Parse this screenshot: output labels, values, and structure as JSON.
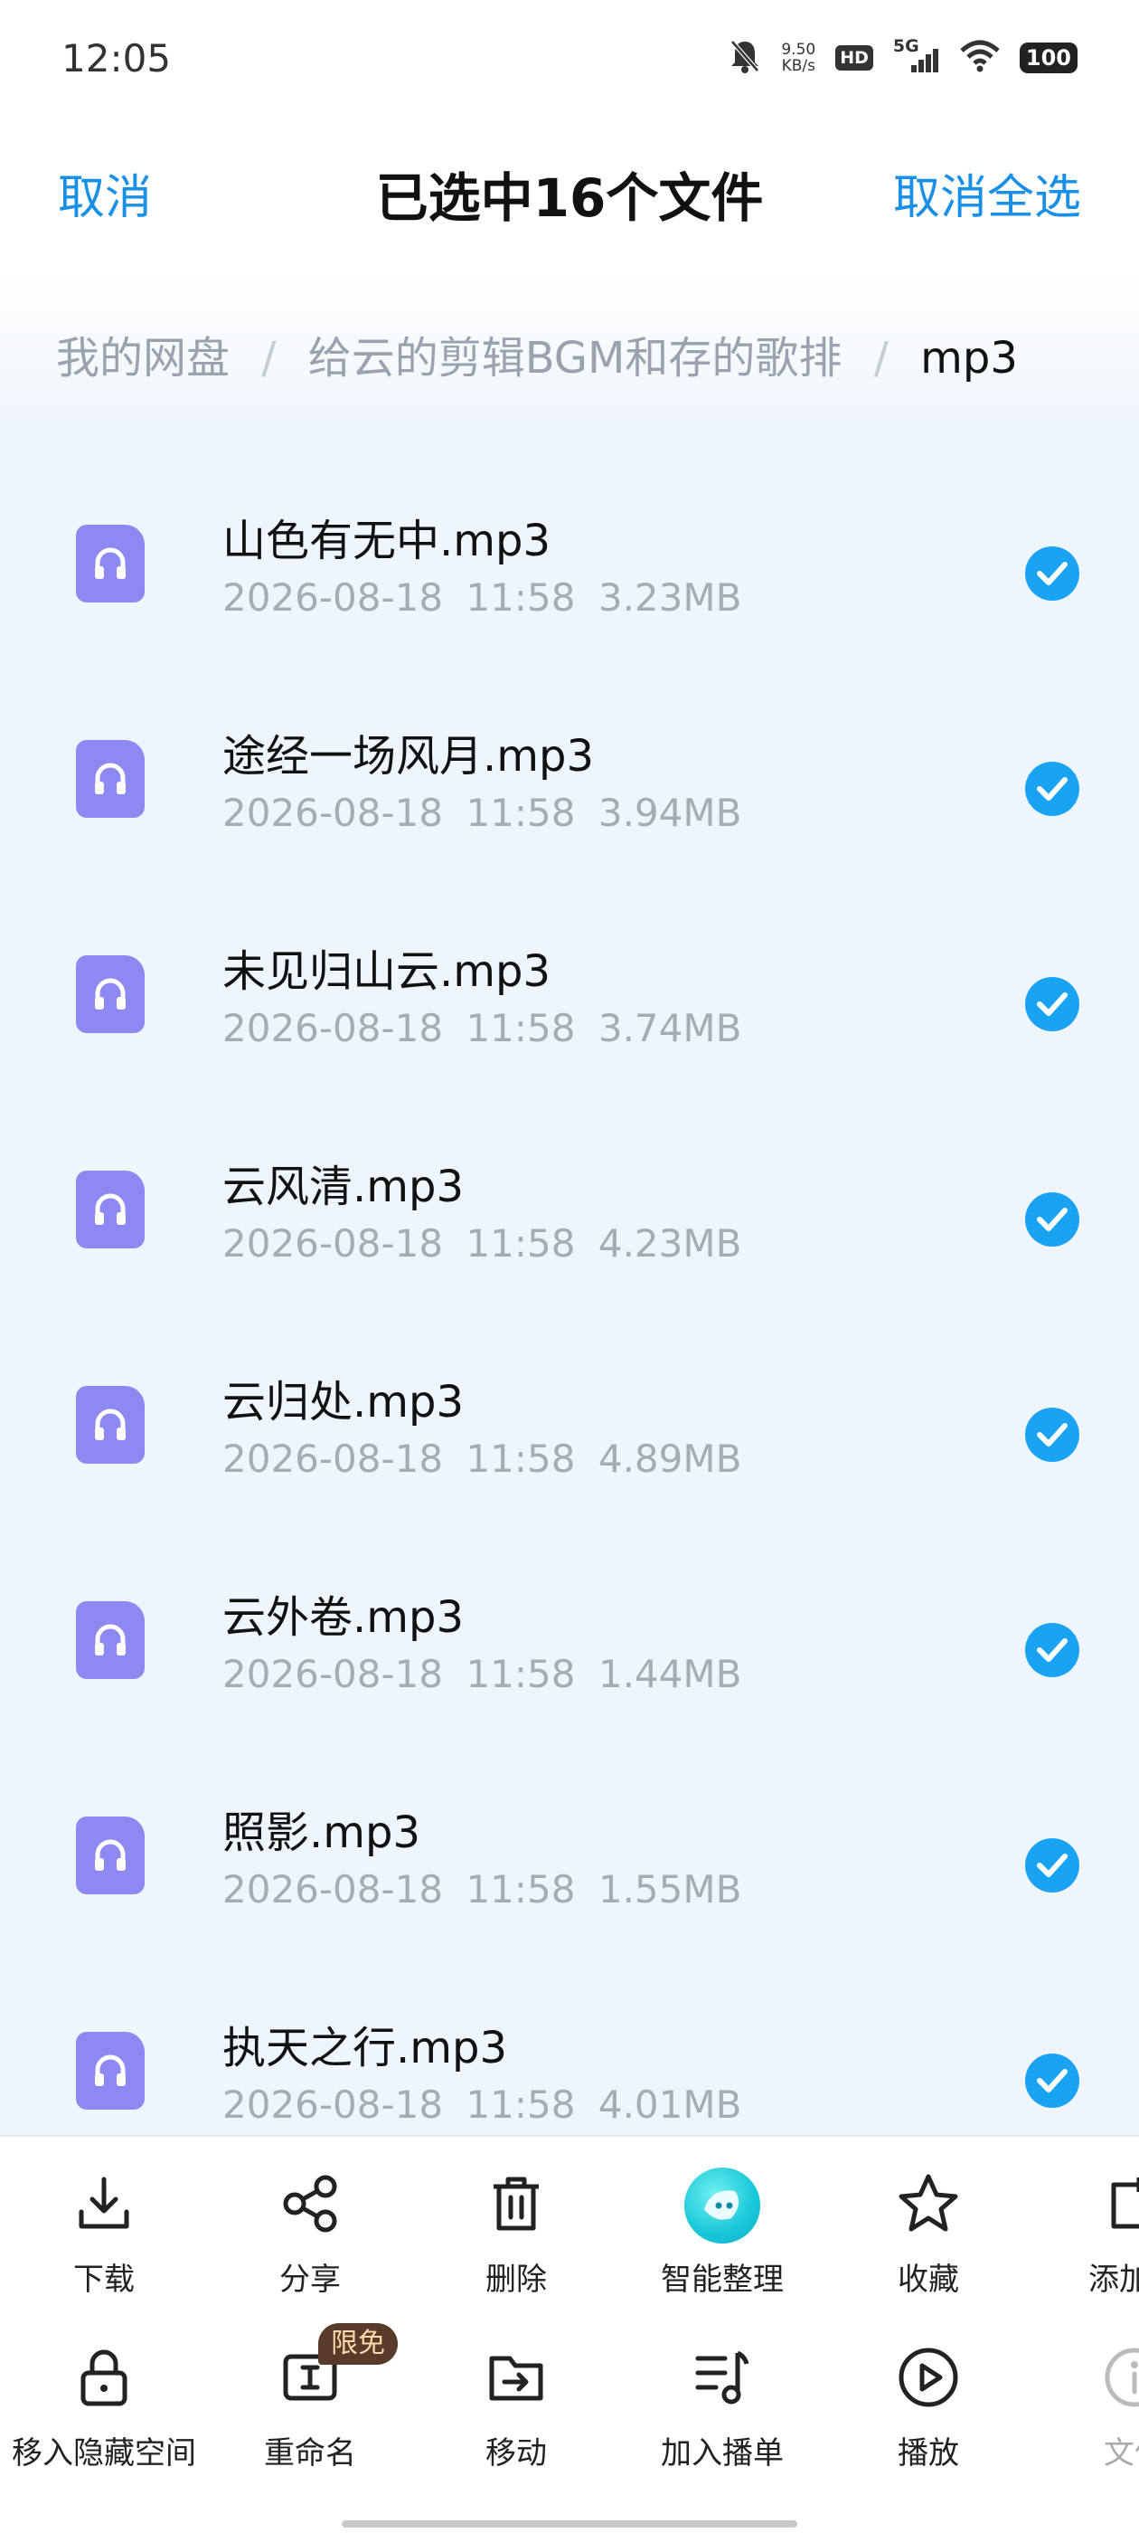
{
  "status_bar": {
    "time": "12:05",
    "net_speed_value": "9.50",
    "net_speed_unit": "KB/s",
    "hd": "HD",
    "signal": "5G",
    "battery": "100",
    "icons": [
      "bell-mute-icon",
      "hd-icon",
      "signal-5g-icon",
      "wifi-icon",
      "battery-icon"
    ]
  },
  "header": {
    "cancel": "取消",
    "title": "已选中16个文件",
    "deselect_all": "取消全选"
  },
  "breadcrumb": {
    "items": [
      "我的网盘",
      "给云的剪辑BGM和存的歌排",
      "mp3"
    ],
    "separator": "/"
  },
  "files": [
    {
      "name": "山色有无中.mp3",
      "date": "2026-08-18",
      "time": "11:58",
      "size": "3.23MB",
      "checked": true
    },
    {
      "name": "途经一场风月.mp3",
      "date": "2026-08-18",
      "time": "11:58",
      "size": "3.94MB",
      "checked": true
    },
    {
      "name": "未见归山云.mp3",
      "date": "2026-08-18",
      "time": "11:58",
      "size": "3.74MB",
      "checked": true
    },
    {
      "name": "云风清.mp3",
      "date": "2026-08-18",
      "time": "11:58",
      "size": "4.23MB",
      "checked": true
    },
    {
      "name": "云归处.mp3",
      "date": "2026-08-18",
      "time": "11:58",
      "size": "4.89MB",
      "checked": true
    },
    {
      "name": "云外卷.mp3",
      "date": "2026-08-18",
      "time": "11:58",
      "size": "1.44MB",
      "checked": true
    },
    {
      "name": "照影.mp3",
      "date": "2026-08-18",
      "time": "11:58",
      "size": "1.55MB",
      "checked": true
    },
    {
      "name": "执天之行.mp3",
      "date": "2026-08-18",
      "time": "11:58",
      "size": "4.01MB",
      "checked": true
    }
  ],
  "toolbar": {
    "row1": [
      {
        "label": "下载",
        "icon": "download-icon"
      },
      {
        "label": "分享",
        "icon": "share-icon"
      },
      {
        "label": "删除",
        "icon": "trash-icon"
      },
      {
        "label": "智能整理",
        "icon": "ai-organize-icon"
      },
      {
        "label": "收藏",
        "icon": "star-icon"
      },
      {
        "label": "添加到",
        "icon": "add-to-icon"
      }
    ],
    "row2": [
      {
        "label": "移入隐藏空间",
        "icon": "lock-icon"
      },
      {
        "label": "重命名",
        "icon": "rename-icon"
      },
      {
        "label": "移动",
        "icon": "move-icon"
      },
      {
        "label": "加入播单",
        "icon": "playlist-add-icon"
      },
      {
        "label": "播放",
        "icon": "play-icon"
      },
      {
        "label": "文件",
        "icon": "info-icon"
      }
    ],
    "rename_badge": "限免"
  },
  "colors": {
    "accent": "#1a8fe6",
    "check": "#1aa3f2",
    "file_icon": "#8d88f2",
    "list_bg": "#eef5fc"
  }
}
